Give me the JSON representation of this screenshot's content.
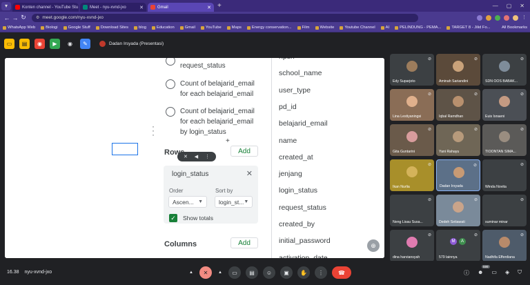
{
  "browser": {
    "tabs": [
      {
        "label": "Konten channel - YouTube Stu",
        "fav_color": "#ff0000",
        "active": false
      },
      {
        "label": "Meet - nyu-xvnd-jxo",
        "fav_color": "#00897b",
        "active": false
      },
      {
        "label": "Gmail",
        "fav_color": "#ea4335",
        "active": true
      }
    ],
    "url": "meet.google.com/nyu-xvnd-jxo",
    "bookmarks": [
      "WhatsApp Web",
      "Biologi",
      "Google Stuff",
      "Download Sites",
      "blog",
      "Education",
      "Gmail",
      "YouTube",
      "Maps",
      "Energy conservation...",
      "Film",
      "Website",
      "Youtube Channel",
      "AI",
      "PELINDUNG - PEMA...",
      "TARGET 8 - Jilid Fo..."
    ],
    "all_bookmarks": "All Bookmarks"
  },
  "meet_top": {
    "presenter": "Dadan Irsyada (Presentasi)",
    "buttons": [
      {
        "icon": "folder-icon",
        "color": "#fbbc04"
      },
      {
        "icon": "document-icon",
        "color": "#fbbc04"
      },
      {
        "icon": "broadcast-icon",
        "color": "#ea4335"
      },
      {
        "icon": "video-icon",
        "color": "#34a853"
      },
      {
        "icon": "eye-icon",
        "color": "#e8eaed"
      },
      {
        "icon": "pen-icon",
        "color": "#4285f4"
      }
    ]
  },
  "share": {
    "options": [
      {
        "text": "request_status"
      },
      {
        "text": "Count of belajarid_email for each belajarid_email"
      },
      {
        "text": "Count of belajarid_email for each belajarid_email by login_status"
      }
    ],
    "rows_label": "Rows",
    "columns_label": "Columns",
    "add_label": "Add",
    "card": {
      "title": "login_status",
      "order_label": "Order",
      "order_value": "Ascen...",
      "sortby_label": "Sort by",
      "sortby_value": "login_st...",
      "show_totals": "Show totals"
    },
    "fields": [
      "npsn",
      "school_name",
      "user_type",
      "pd_id",
      "belajarid_email",
      "name",
      "created_at",
      "jenjang",
      "login_status",
      "request_status",
      "created_by",
      "initial_password",
      "activation_date"
    ]
  },
  "participants": [
    {
      "name": "Edy Suparjoto",
      "color": "#3c4043",
      "avatar": "#9c7c5c"
    },
    {
      "name": "Aminah Sariandini",
      "color": "#5b4a3a",
      "avatar": "#c9a27a"
    },
    {
      "name": "SDN OOS BABAK...",
      "color": "#3c4043",
      "avatar": "#7e8c9a"
    },
    {
      "name": "Lina Lestiyaningsi",
      "color": "#8a6d56",
      "avatar": "#e0b08c"
    },
    {
      "name": "Iqbal Ramdhan",
      "color": "#5e5347",
      "avatar": "#b8906e"
    },
    {
      "name": "Euis Isnaeni",
      "color": "#4b4f55",
      "avatar": "#c49a82"
    },
    {
      "name": "Gita Guntarini",
      "color": "#6a5a4a",
      "avatar": "#d89c9c"
    },
    {
      "name": "Yani Rahayu",
      "color": "#6f6656",
      "avatar": "#b79a7b"
    },
    {
      "name": "TIOONTAN SIMA...",
      "color": "#5b5a58",
      "avatar": "#9a8d80"
    },
    {
      "name": "Ikan Nurlia",
      "color": "#a88f2a",
      "avatar": "#d4b35a"
    },
    {
      "name": "Dadan Irsyada",
      "color": "#5c7088",
      "avatar": "#c79a74"
    },
    {
      "name": "Winda Novita",
      "color": "#3c4043",
      "avatar": "#3c4043"
    },
    {
      "name": "Neng Lisau Susa...",
      "color": "#3c4043",
      "avatar": "#3c4043"
    },
    {
      "name": "Dedeh Setiawati",
      "color": "#7a8a9a",
      "avatar": "#c9a48a"
    },
    {
      "name": "suminar minar",
      "color": "#3c4043",
      "avatar": "#3c4043"
    },
    {
      "name": "dina harviansyah",
      "color": "#3c4043",
      "avatar": "#e07bb0"
    },
    {
      "name": "579 lainnya",
      "color": "#3c4043",
      "avatar": "#3c4043"
    },
    {
      "name": "Nadhifa Efferdiana",
      "color": "#4e5b6a",
      "avatar": "#b88a6a"
    }
  ],
  "more_avatars": [
    "M",
    "A"
  ],
  "bottom": {
    "time": "16.38",
    "meeting_code": "nyu-xvnd-jxo",
    "participant_count": "599"
  }
}
